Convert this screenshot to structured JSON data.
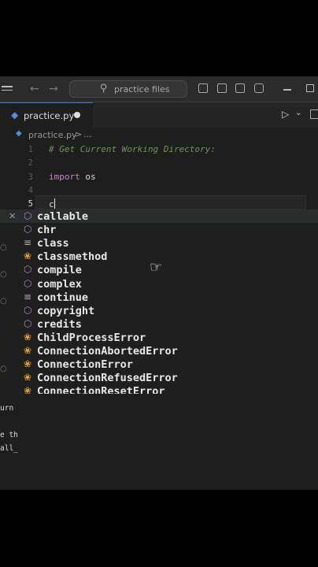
{
  "window": {
    "search_label": "practice files"
  },
  "tabs": [
    {
      "label": "practice.py"
    }
  ],
  "breadcrumb": {
    "file": "practice.py",
    "separator": ">",
    "more": "..."
  },
  "editor": {
    "lines": [
      {
        "number": "1",
        "text": "# Get Current Working Directory:"
      },
      {
        "number": "2",
        "text": ""
      },
      {
        "number": "3",
        "keyword": "import",
        "text": " os"
      },
      {
        "number": "4",
        "text": ""
      },
      {
        "number": "5",
        "text": "c"
      }
    ]
  },
  "suggestions": [
    {
      "label": "callable",
      "icon": "cube-icon"
    },
    {
      "label": "chr",
      "icon": "cube-icon"
    },
    {
      "label": "class",
      "icon": "snippet-icon"
    },
    {
      "label": "classmethod",
      "icon": "class-icon"
    },
    {
      "label": "compile",
      "icon": "cube-icon"
    },
    {
      "label": "complex",
      "icon": "cube-icon"
    },
    {
      "label": "continue",
      "icon": "snippet-icon"
    },
    {
      "label": "copyright",
      "icon": "cube-icon"
    },
    {
      "label": "credits",
      "icon": "cube-icon"
    },
    {
      "label": "ChildProcessError",
      "icon": "class-icon"
    },
    {
      "label": "ConnectionAbortedError",
      "icon": "class-icon"
    },
    {
      "label": "ConnectionError",
      "icon": "class-icon"
    },
    {
      "label": "ConnectionRefusedError",
      "icon": "class-icon"
    },
    {
      "label": "ConnectionResetError",
      "icon": "class-icon"
    }
  ],
  "panel_fragments": [
    "urn ",
    "e th",
    "all_"
  ],
  "colors": {
    "accent": "#2f7fd6",
    "comment": "#6a9955",
    "keyword": "#c586c0",
    "class_icon": "#ee9d28",
    "function_icon": "#b180d7"
  }
}
